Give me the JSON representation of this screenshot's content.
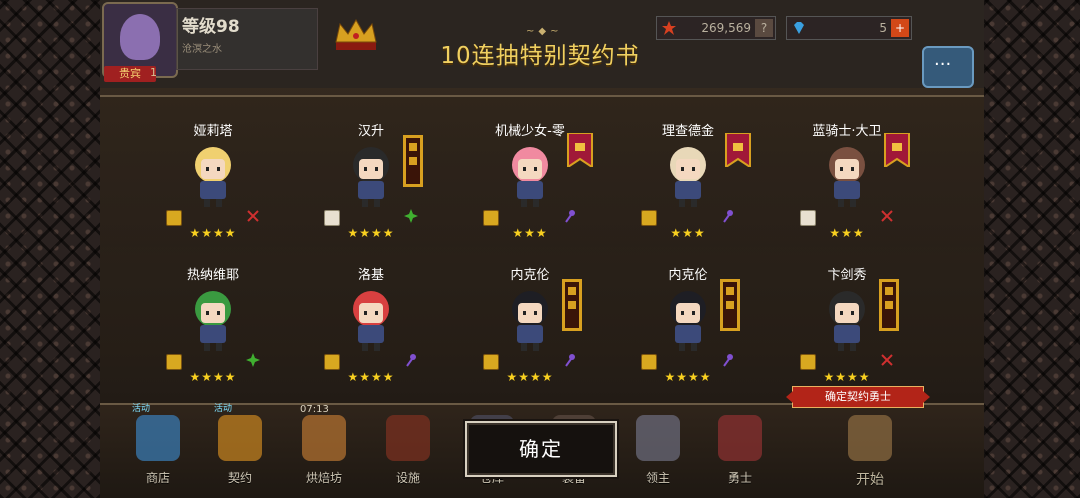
{
  "hud": {
    "level": "等级98",
    "subtitle": "沧溟之水",
    "badge": "贵宾",
    "badge_num": "1",
    "gold": "269,569",
    "gold_btn": "?",
    "gems": "5",
    "gems_btn": "+"
  },
  "popup": {
    "title": "10连抽特别契约书",
    "confirm_label": "确定",
    "confirm_badge": "确定契约勇士"
  },
  "heroes": [
    {
      "name": "娅莉塔",
      "stars": "★★★★",
      "scroll": "gold",
      "cls": "sword"
    },
    {
      "name": "汉升",
      "stars": "★★★★",
      "scroll": "white",
      "cls": "cross",
      "banner": true
    },
    {
      "name": "机械少女-零",
      "stars": "★★★",
      "scroll": "gold",
      "cls": "staff",
      "banner_mini": true
    },
    {
      "name": "理查德金",
      "stars": "★★★",
      "scroll": "gold",
      "cls": "staff",
      "banner_mini": true
    },
    {
      "name": "蓝骑士·大卫",
      "stars": "★★★",
      "scroll": "white",
      "cls": "sword",
      "banner_mini": true
    },
    {
      "name": "热纳维耶",
      "stars": "★★★★",
      "scroll": "gold",
      "cls": "cross"
    },
    {
      "name": "洛基",
      "stars": "★★★★",
      "scroll": "gold",
      "cls": "staff"
    },
    {
      "name": "内克伦",
      "stars": "★★★★",
      "scroll": "gold",
      "cls": "staff",
      "banner": true
    },
    {
      "name": "内克伦",
      "stars": "★★★★",
      "scroll": "gold",
      "cls": "staff",
      "banner": true
    },
    {
      "name": "卞剑秀",
      "stars": "★★★★",
      "scroll": "gold",
      "cls": "sword",
      "banner": true
    }
  ],
  "bottom_nav": [
    {
      "label": "商店",
      "tag": "活动"
    },
    {
      "label": "契约",
      "tag": "活动"
    },
    {
      "label": "烘焙坊",
      "timer": "07:13"
    },
    {
      "label": "设施"
    },
    {
      "label": "仓库"
    },
    {
      "label": "装备"
    },
    {
      "label": "领主"
    },
    {
      "label": "勇士"
    },
    {
      "label": "开始"
    }
  ],
  "colors": {
    "title": "#f0d060",
    "star": "#f8d020",
    "badge_red": "#b22418"
  }
}
